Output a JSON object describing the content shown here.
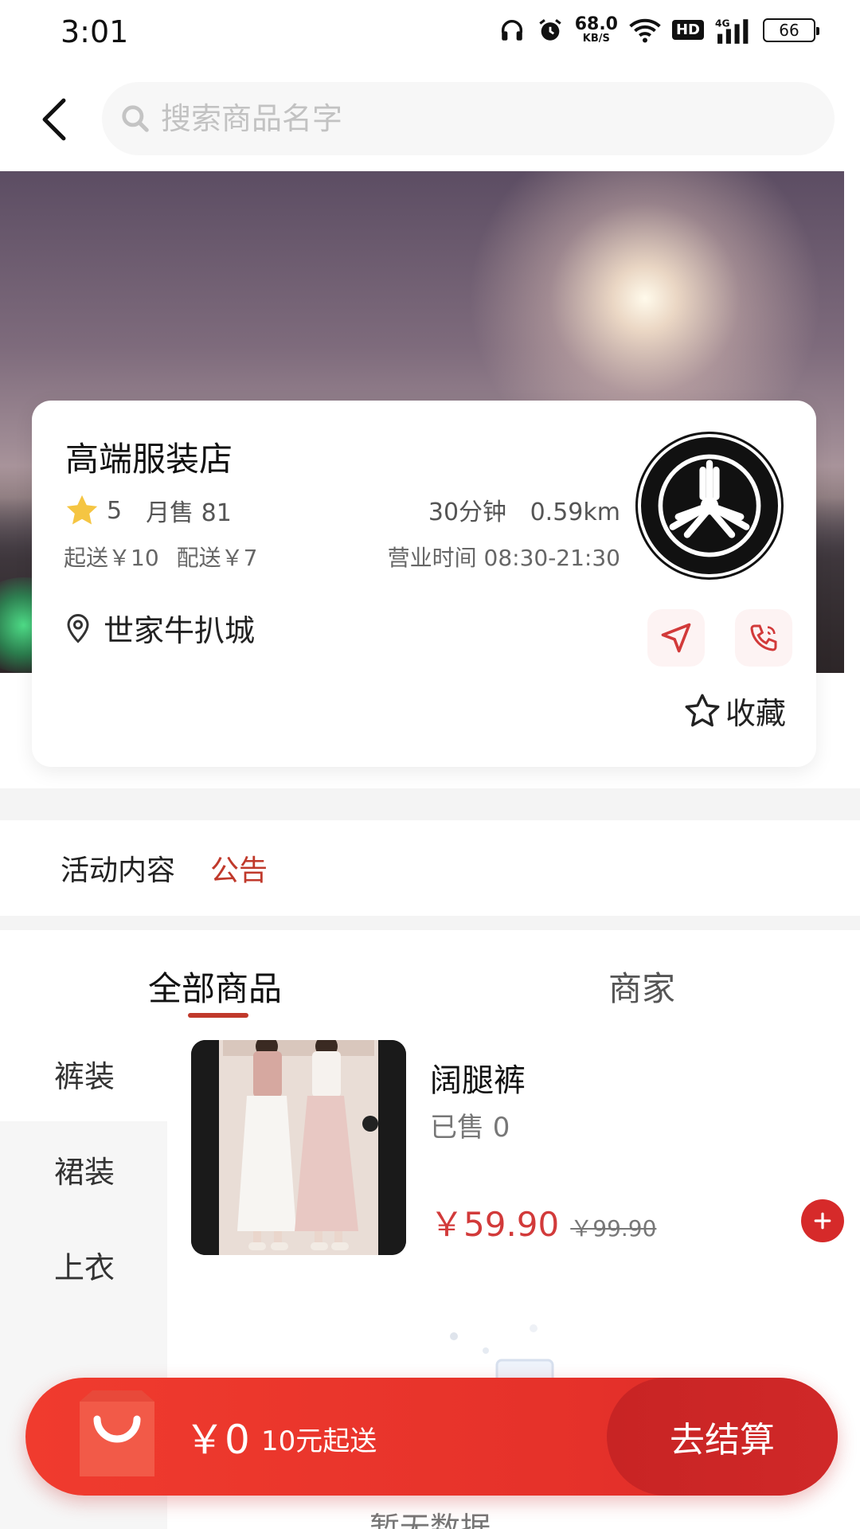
{
  "status_bar": {
    "time": "3:01",
    "net_speed_value": "68.0",
    "net_speed_unit": "KB/S",
    "hd": "HD",
    "network": "4G",
    "battery": "66"
  },
  "header": {
    "search_placeholder": "搜索商品名字"
  },
  "store": {
    "name": "高端服装店",
    "rating": "5",
    "monthly_sales": "月售 81",
    "delivery_time": "30分钟",
    "distance": "0.59km",
    "min_order": "起送￥10",
    "delivery_fee": "配送￥7",
    "hours": "营业时间 08:30-21:30",
    "address": "世家牛扒城",
    "collect_label": "收藏"
  },
  "notice": {
    "activity_label": "活动内容",
    "announcement_label": "公告"
  },
  "tabs": [
    {
      "label": "全部商品"
    },
    {
      "label": "商家"
    }
  ],
  "categories": [
    {
      "label": "裤装"
    },
    {
      "label": "裙装"
    },
    {
      "label": "上衣"
    }
  ],
  "products": [
    {
      "name": "阔腿裤",
      "sold": "已售 0",
      "price": "￥59.90",
      "original_price": "￥99.90"
    }
  ],
  "empty_text": "暂无数据",
  "cart": {
    "total": "￥0",
    "min_order_text": "10元起送",
    "checkout_label": "去结算"
  },
  "colors": {
    "accent": "#d62a2a",
    "announcement": "#c0392b"
  }
}
